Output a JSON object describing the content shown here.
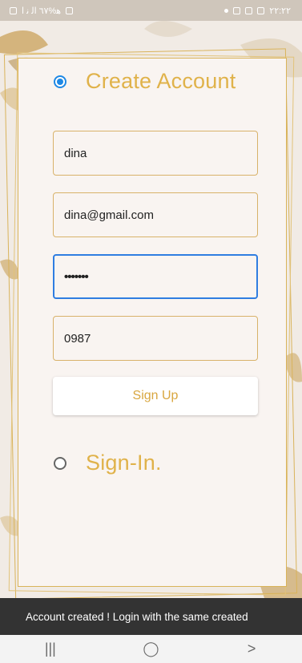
{
  "status_bar": {
    "left_text": "ﻫ%٦٧ ﺍﻟ ﻧ ﺍ",
    "time": "٢٢:٢٢"
  },
  "form": {
    "create_account_label": "Create Account",
    "create_account_selected": true,
    "name_value": "dina",
    "email_value": "dina@gmail.com",
    "password_value": "•••••••",
    "phone_value": "0987",
    "signup_label": "Sign Up",
    "signin_label": "Sign-In.",
    "signin_selected": false
  },
  "snackbar": {
    "message": "Account created ! Login with the same created"
  },
  "navbar": {
    "recent_glyph": "|||",
    "home_glyph": "◯",
    "back_glyph": ">"
  },
  "colors": {
    "accent_gold": "#e0b24a",
    "focus_blue": "#2f7de1",
    "snackbar_bg": "#333333"
  }
}
